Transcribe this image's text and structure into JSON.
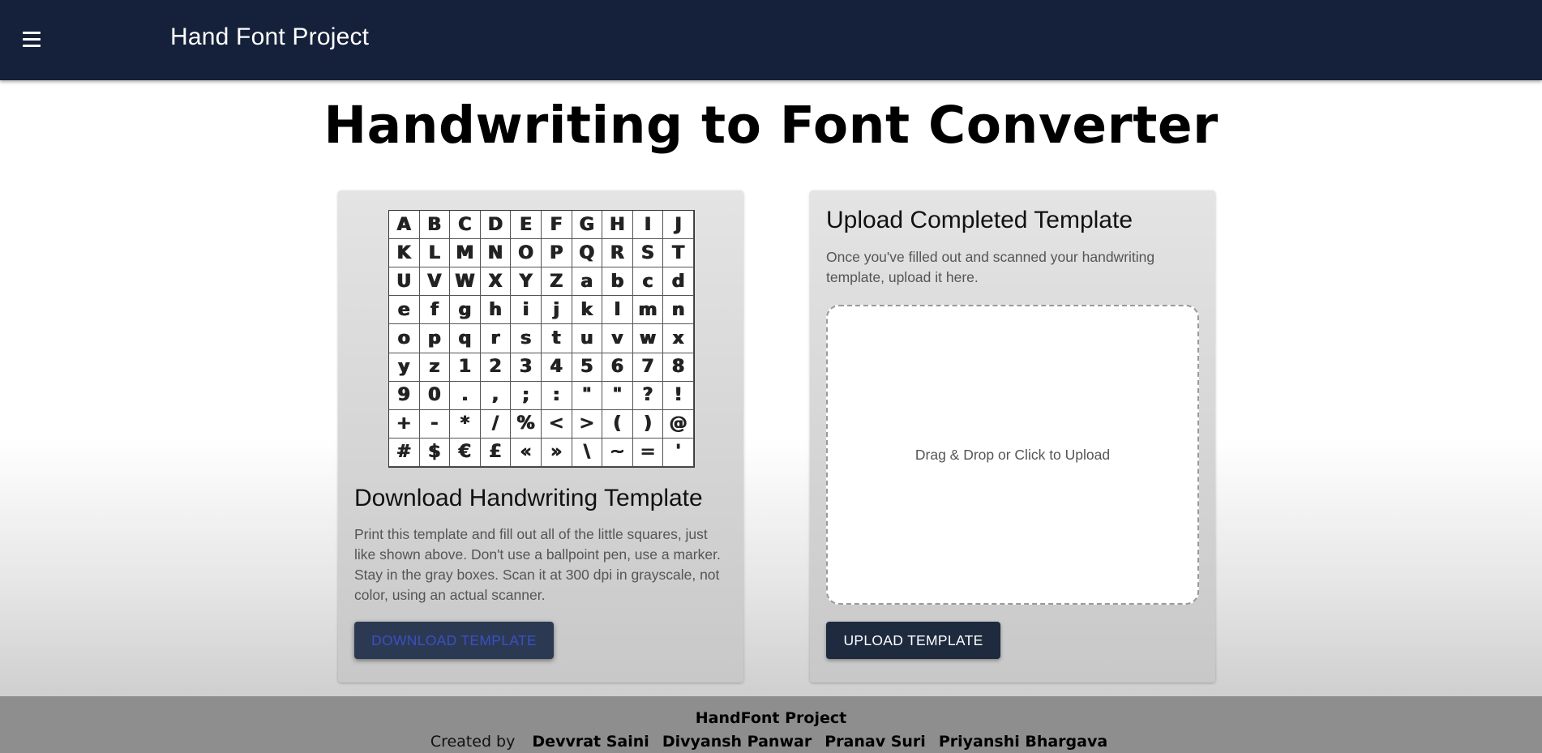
{
  "appbar": {
    "title": "Hand Font Project",
    "menu_icon": "hamburger-menu-icon",
    "background": "#15213a"
  },
  "page": {
    "title": "Handwriting to Font Converter"
  },
  "download_card": {
    "template_chars": [
      "A",
      "B",
      "C",
      "D",
      "E",
      "F",
      "G",
      "H",
      "I",
      "J",
      "K",
      "L",
      "M",
      "N",
      "O",
      "P",
      "Q",
      "R",
      "S",
      "T",
      "U",
      "V",
      "W",
      "X",
      "Y",
      "Z",
      "a",
      "b",
      "c",
      "d",
      "e",
      "f",
      "g",
      "h",
      "i",
      "j",
      "k",
      "l",
      "m",
      "n",
      "o",
      "p",
      "q",
      "r",
      "s",
      "t",
      "u",
      "v",
      "w",
      "x",
      "y",
      "z",
      "1",
      "2",
      "3",
      "4",
      "5",
      "6",
      "7",
      "8",
      "9",
      "0",
      ".",
      ",",
      ";",
      ":",
      "\"",
      "\"",
      "?",
      "!",
      "+",
      "-",
      "*",
      "/",
      "%",
      "<",
      ">",
      "(",
      ")",
      "@",
      "#",
      "$",
      "€",
      "£",
      "«",
      "»",
      "\\",
      "~",
      "=",
      "'"
    ],
    "heading": "Download Handwriting Template",
    "description": "Print this template and fill out all of the little squares, just like shown above. Don't use a ballpoint pen, use a marker. Stay in the gray boxes. Scan it at 300 dpi in grayscale, not color, using an actual scanner.",
    "button_label": "DOWNLOAD TEMPLATE"
  },
  "upload_card": {
    "heading": "Upload Completed Template",
    "description": "Once you've filled out and scanned your handwriting template, upload it here.",
    "dropzone_text": "Drag & Drop or Click to Upload",
    "button_label": "UPLOAD TEMPLATE"
  },
  "footer": {
    "title": "HandFont Project",
    "created_by": "Created by",
    "authors": [
      "Devvrat Saini",
      "Divyansh Panwar",
      "Pranav Suri",
      "Priyanshi Bhargava"
    ]
  }
}
